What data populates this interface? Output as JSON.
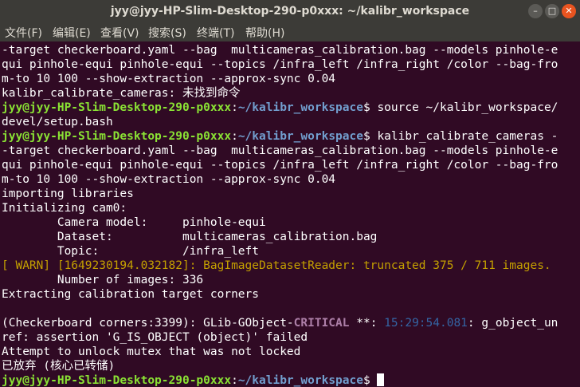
{
  "window": {
    "title": "jyy@jyy-HP-Slim-Desktop-290-p0xxx: ~/kalibr_workspace",
    "minimize_glyph": "–",
    "maximize_glyph": "□",
    "close_glyph": "✕"
  },
  "menu": [
    "文件(F)",
    "编辑(E)",
    "查看(V)",
    "搜索(S)",
    "终端(T)",
    "帮助(H)"
  ],
  "prompt": {
    "user": "jyy@jyy-HP-Slim-Desktop-290-p0xxx",
    "sep": ":",
    "path": "~/kalibr_workspace",
    "sign": "$ "
  },
  "lines": [
    "-target checkerboard.yaml --bag  multicameras_calibration.bag --models pinhole-e",
    "qui pinhole-equi pinhole-equi --topics /infra_left /infra_right /color --bag-fro",
    "m-to 10 100 --show-extraction --approx-sync 0.04",
    "kalibr_calibrate_cameras: 未找到命令",
    "source ~/kalibr_workspace/",
    "devel/setup.bash",
    "kalibr_calibrate_cameras -",
    "-target checkerboard.yaml --bag  multicameras_calibration.bag --models pinhole-e",
    "qui pinhole-equi pinhole-equi --topics /infra_left /infra_right /color --bag-fro",
    "m-to 10 100 --show-extraction --approx-sync 0.04",
    "importing libraries",
    "Initializing cam0:",
    "        Camera model:     pinhole-equi",
    "        Dataset:          multicameras_calibration.bag",
    "        Topic:            /infra_left",
    "[ WARN] [1649230194.032182]: BagImageDatasetReader: truncated 375 / 711 images.",
    "        Number of images: 336",
    "Extracting calibration target corners",
    "(Checkerboard corners:3399): GLib-GObject-",
    "CRITICAL",
    " **: ",
    "15:29:54.081",
    ": g_object_un",
    "ref: assertion 'G_IS_OBJECT (object)' failed",
    "Attempt to unlock mutex that was not locked",
    "已放弃 (核心已转储)"
  ]
}
